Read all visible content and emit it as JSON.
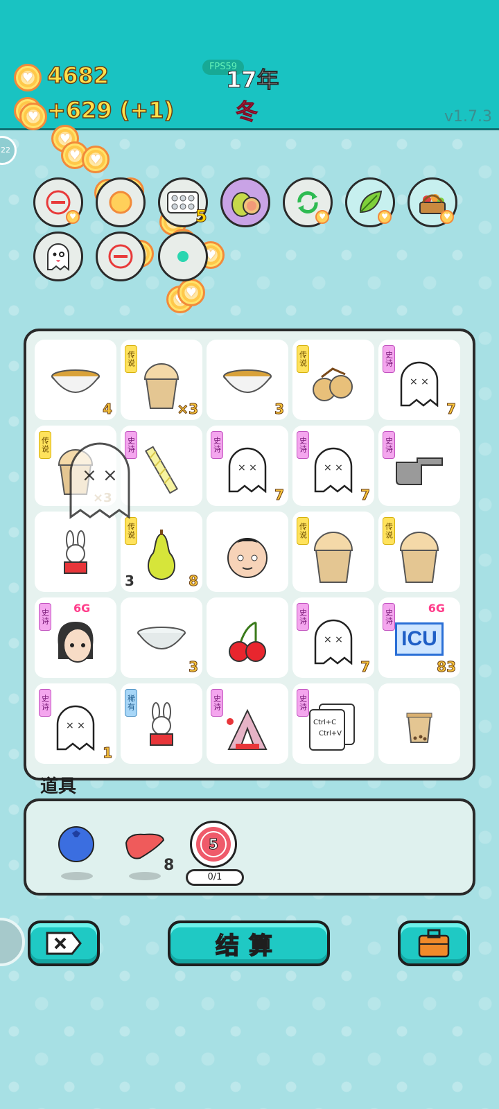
{
  "header": {
    "coins_total": "4682",
    "coins_income": "+629 (+1)",
    "fps": "FPS59",
    "year": "17年",
    "season": "冬",
    "version": "v1.7.3",
    "level_badge": "22"
  },
  "skills": {
    "row1": [
      {
        "name": "minus-icon",
        "coin": true
      },
      {
        "name": "coin-stack-icon",
        "coin": false
      },
      {
        "name": "pill-pack-icon",
        "count": "5"
      },
      {
        "name": "pomelo-icon",
        "coin": false
      },
      {
        "name": "refresh-icon",
        "coin": true
      },
      {
        "name": "leaf-icon",
        "coin": true
      },
      {
        "name": "fruit-basket-icon",
        "coin": true
      }
    ],
    "row2": [
      {
        "name": "ghost-icon"
      },
      {
        "name": "minus-icon-2"
      },
      {
        "name": "teal-bubble-icon"
      }
    ]
  },
  "board": {
    "tags": {
      "legend": "传说",
      "epic": "史诗",
      "rare": "稀有"
    },
    "cells": [
      {
        "id": "r1c1",
        "icon": "bowl-of-soup-icon",
        "tag": "",
        "num": "4"
      },
      {
        "id": "r1c2",
        "icon": "milk-tea-cup-icon",
        "tag": "legend",
        "num": "×3"
      },
      {
        "id": "r1c3",
        "icon": "bowl-of-soup-icon",
        "tag": "",
        "num": "3"
      },
      {
        "id": "r1c4",
        "icon": "longan-icon",
        "tag": "legend",
        "num": ""
      },
      {
        "id": "r1c5",
        "icon": "ghost-icon",
        "tag": "epic",
        "num": "7"
      },
      {
        "id": "r2c1",
        "icon": "milk-tea-cup-icon",
        "tag": "legend",
        "num": ""
      },
      {
        "id": "r2c2",
        "icon": "straw-icon",
        "tag": "epic",
        "num": ""
      },
      {
        "id": "r2c3",
        "icon": "ghost-icon",
        "tag": "epic",
        "num": "7"
      },
      {
        "id": "r2c4",
        "icon": "ghost-icon",
        "tag": "epic",
        "num": "7"
      },
      {
        "id": "r2c5",
        "icon": "pointing-hand-icon",
        "tag": "epic",
        "num": ""
      },
      {
        "id": "r3c1",
        "icon": "bunny-icon",
        "tag": "",
        "num": ""
      },
      {
        "id": "r3c2",
        "icon": "pear-icon",
        "tag": "legend",
        "num": "8",
        "num_left": "3"
      },
      {
        "id": "r3c3",
        "icon": "cartoon-face-icon",
        "tag": "",
        "num": ""
      },
      {
        "id": "r3c4",
        "icon": "milk-tea-cup-icon",
        "tag": "legend",
        "num": ""
      },
      {
        "id": "r3c5",
        "icon": "milk-tea-cup-icon",
        "tag": "legend",
        "num": ""
      },
      {
        "id": "r4c1",
        "icon": "girl-face-icon",
        "tag": "epic",
        "num": "",
        "gen": "6G"
      },
      {
        "id": "r4c2",
        "icon": "empty-bowl-icon",
        "tag": "",
        "num": "3"
      },
      {
        "id": "r4c3",
        "icon": "cherries-icon",
        "tag": "",
        "num": ""
      },
      {
        "id": "r4c4",
        "icon": "ghost-icon",
        "tag": "epic",
        "num": "7"
      },
      {
        "id": "r4c5",
        "icon": "icu-sign-icon",
        "tag": "epic",
        "num": "83",
        "gen": "6G",
        "sign": "ICU"
      },
      {
        "id": "r5c1",
        "icon": "ghost-icon",
        "tag": "epic",
        "num": "1"
      },
      {
        "id": "r5c2",
        "icon": "bunny-icon",
        "tag": "rare",
        "num": ""
      },
      {
        "id": "r5c3",
        "icon": "bunny-tent-icon",
        "tag": "epic",
        "num": ""
      },
      {
        "id": "r5c4",
        "icon": "copy-paste-cards-icon",
        "tag": "epic",
        "num": "",
        "text1": "Ctrl+C",
        "text2": "Ctrl+V"
      },
      {
        "id": "r5c5",
        "icon": "small-tea-cup-icon",
        "tag": "",
        "num": ""
      }
    ],
    "floating_ghost_multiplier": "×3"
  },
  "items": {
    "title": "道具",
    "list": [
      {
        "name": "blueberry-icon",
        "count": ""
      },
      {
        "name": "liver-icon",
        "count": "8"
      },
      {
        "name": "target-icon",
        "count": "5",
        "progress": "0/1"
      }
    ]
  },
  "buttons": {
    "settle": "结算"
  },
  "colors": {
    "header_bg": "#19c3c2",
    "button_teal": "#1fc9c4",
    "coin_text": "#ffe04a",
    "season_red": "#ff2f5a"
  }
}
